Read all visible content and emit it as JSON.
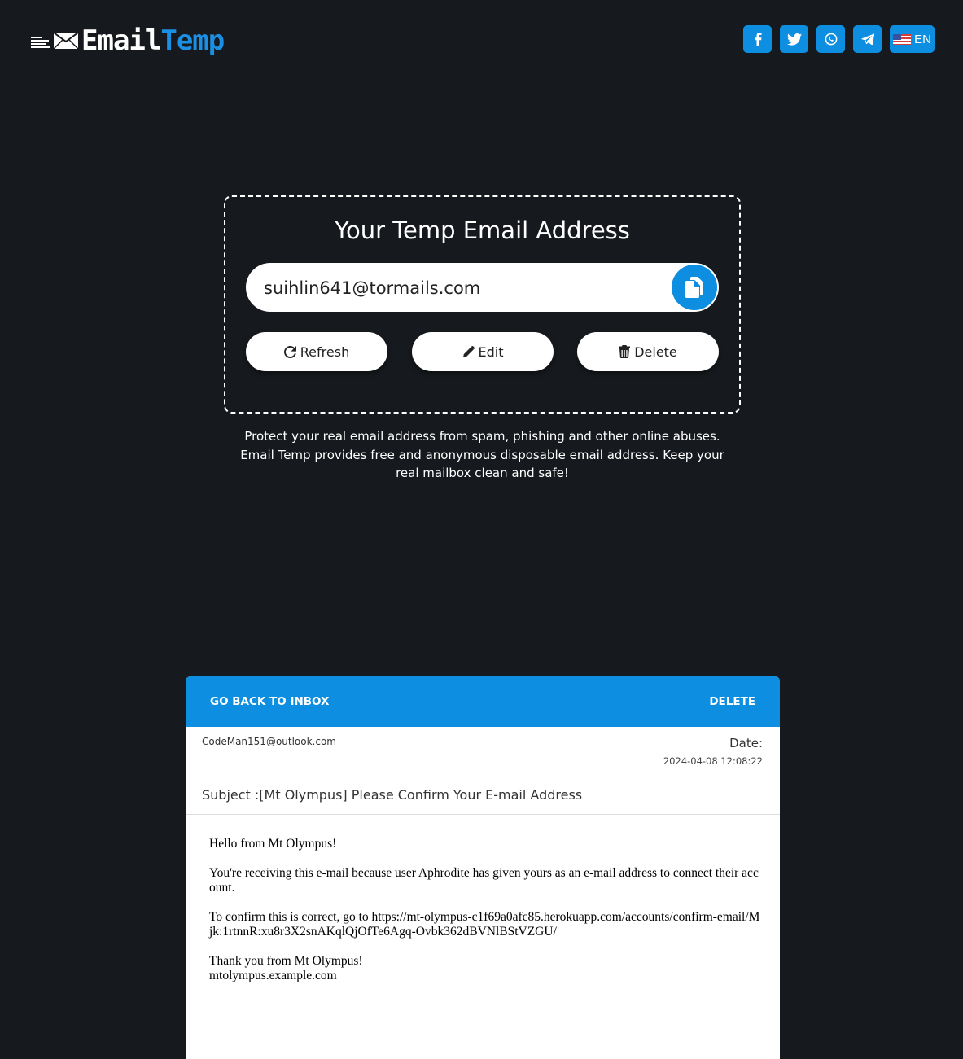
{
  "brand": {
    "name_part1": "Email",
    "name_part2": "Temp",
    "accent_color": "#1a8fe3"
  },
  "header": {
    "social_icons": [
      "facebook-icon",
      "twitter-icon",
      "whatsapp-icon",
      "telegram-icon"
    ],
    "language_label": "EN"
  },
  "email_card": {
    "title": "Your Temp Email Address",
    "email_value": "suihlin641@tormails.com",
    "buttons": {
      "refresh": "Refresh",
      "edit": "Edit",
      "delete": "Delete"
    }
  },
  "tagline": "Protect your real email address from spam, phishing and other online abuses. Email Temp provides free and anonymous disposable email address. Keep your real mailbox clean and safe!",
  "mail": {
    "back_label": "GO BACK TO INBOX",
    "delete_label": "DELETE",
    "sender": "CodeMan151@outlook.com",
    "date_label": "Date:",
    "date_value": "2024-04-08 12:08:22",
    "subject": "Subject :[Mt Olympus] Please Confirm Your E-mail Address",
    "body": {
      "greeting": "Hello from Mt Olympus!",
      "para1": "You're receiving this e-mail because user Aphrodite has given yours as an e-mail address to connect their account.",
      "para2": "To confirm this is correct, go to https://mt-olympus-c1f69a0afc85.herokuapp.com/accounts/confirm-email/Mjk:1rtnnR:xu8r3X2snAKqlQjOfTe6Agq-Ovbk362dBVNlBStVZGU/",
      "thanks": "Thank you from Mt Olympus!",
      "site": "mtolympus.example.com"
    }
  }
}
